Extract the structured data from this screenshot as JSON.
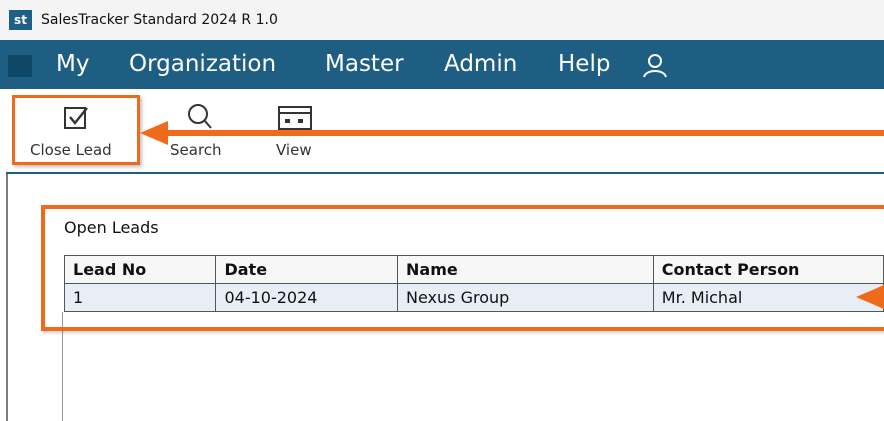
{
  "window": {
    "logo_text": "st",
    "title": "SalesTracker Standard 2024 R 1.0"
  },
  "menu": {
    "items": [
      {
        "label": "My"
      },
      {
        "label": "Organization"
      },
      {
        "label": "Master"
      },
      {
        "label": "Admin"
      },
      {
        "label": "Help"
      }
    ],
    "user_icon": "user-icon"
  },
  "toolbar": {
    "close_lead": {
      "label": "Close Lead",
      "icon": "checkbox-icon"
    },
    "search": {
      "label": "Search",
      "icon": "search-icon"
    },
    "view": {
      "label": "View",
      "icon": "view-icon"
    }
  },
  "open_leads": {
    "title": "Open Leads",
    "columns": [
      "Lead No",
      "Date",
      "Name",
      "Contact Person"
    ],
    "rows": [
      [
        "1",
        "04-10-2024",
        "Nexus Group",
        "Mr. Michal"
      ]
    ]
  },
  "colors": {
    "menu_bg": "#1e5e82",
    "highlight": "#f06a1c",
    "row_bg": "#e7eef6"
  }
}
